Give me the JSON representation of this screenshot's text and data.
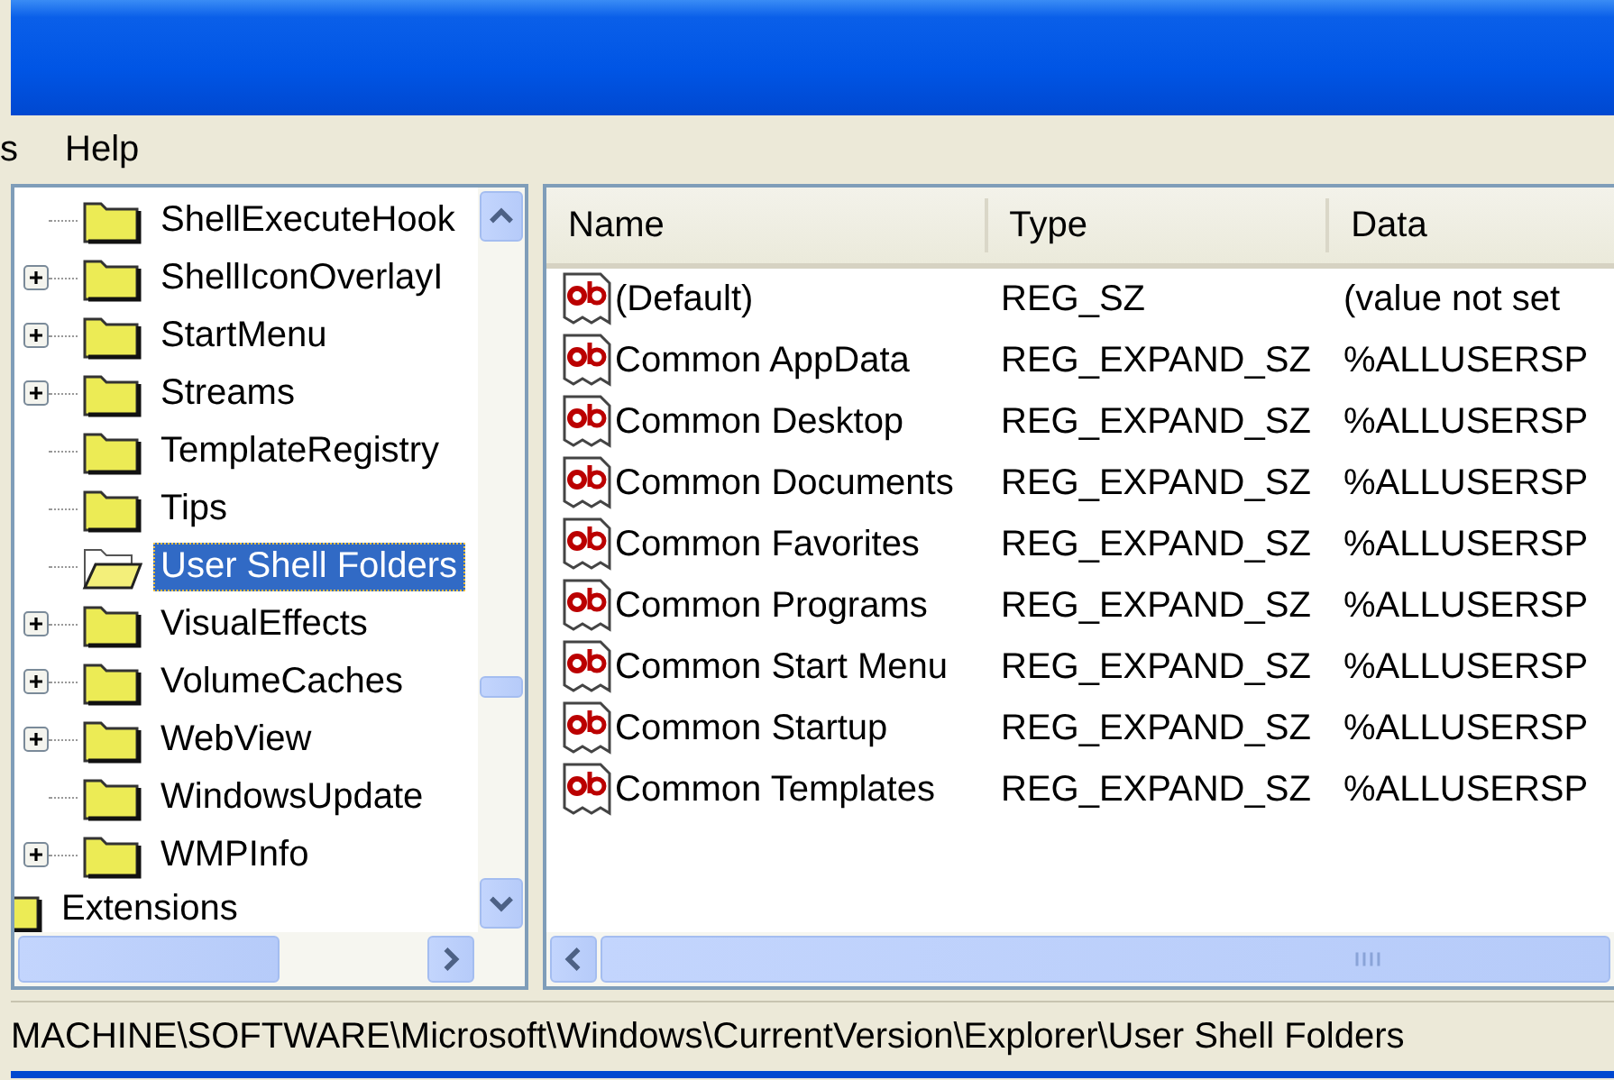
{
  "menu": [
    {
      "label": "s"
    },
    {
      "label": "Help"
    }
  ],
  "tree": {
    "items": [
      {
        "label": "ShellExecuteHook",
        "expandable": false,
        "selected": false
      },
      {
        "label": "ShellIconOverlayI",
        "expandable": true,
        "selected": false
      },
      {
        "label": "StartMenu",
        "expandable": true,
        "selected": false
      },
      {
        "label": "Streams",
        "expandable": true,
        "selected": false
      },
      {
        "label": "TemplateRegistry",
        "expandable": false,
        "selected": false
      },
      {
        "label": "Tips",
        "expandable": false,
        "selected": false
      },
      {
        "label": "User Shell Folders",
        "expandable": false,
        "selected": true
      },
      {
        "label": "VisualEffects",
        "expandable": true,
        "selected": false
      },
      {
        "label": "VolumeCaches",
        "expandable": true,
        "selected": false
      },
      {
        "label": "WebView",
        "expandable": true,
        "selected": false
      },
      {
        "label": "WindowsUpdate",
        "expandable": false,
        "selected": false
      },
      {
        "label": "WMPInfo",
        "expandable": true,
        "selected": false
      }
    ],
    "next_items": [
      {
        "label": "Extensions"
      }
    ]
  },
  "list": {
    "columns": [
      "Name",
      "Type",
      "Data"
    ],
    "rows": [
      {
        "name": "(Default)",
        "type": "REG_SZ",
        "data": "(value not set"
      },
      {
        "name": "Common AppData",
        "type": "REG_EXPAND_SZ",
        "data": "%ALLUSERSP"
      },
      {
        "name": "Common Desktop",
        "type": "REG_EXPAND_SZ",
        "data": "%ALLUSERSP"
      },
      {
        "name": "Common Documents",
        "type": "REG_EXPAND_SZ",
        "data": "%ALLUSERSP"
      },
      {
        "name": "Common Favorites",
        "type": "REG_EXPAND_SZ",
        "data": "%ALLUSERSP"
      },
      {
        "name": "Common Programs",
        "type": "REG_EXPAND_SZ",
        "data": "%ALLUSERSP"
      },
      {
        "name": "Common Start Menu",
        "type": "REG_EXPAND_SZ",
        "data": "%ALLUSERSP"
      },
      {
        "name": "Common Startup",
        "type": "REG_EXPAND_SZ",
        "data": "%ALLUSERSP"
      },
      {
        "name": "Common Templates",
        "type": "REG_EXPAND_SZ",
        "data": "%ALLUSERSP"
      }
    ]
  },
  "status_bar": "MACHINE\\SOFTWARE\\Microsoft\\Windows\\CurrentVersion\\Explorer\\User Shell Folders"
}
